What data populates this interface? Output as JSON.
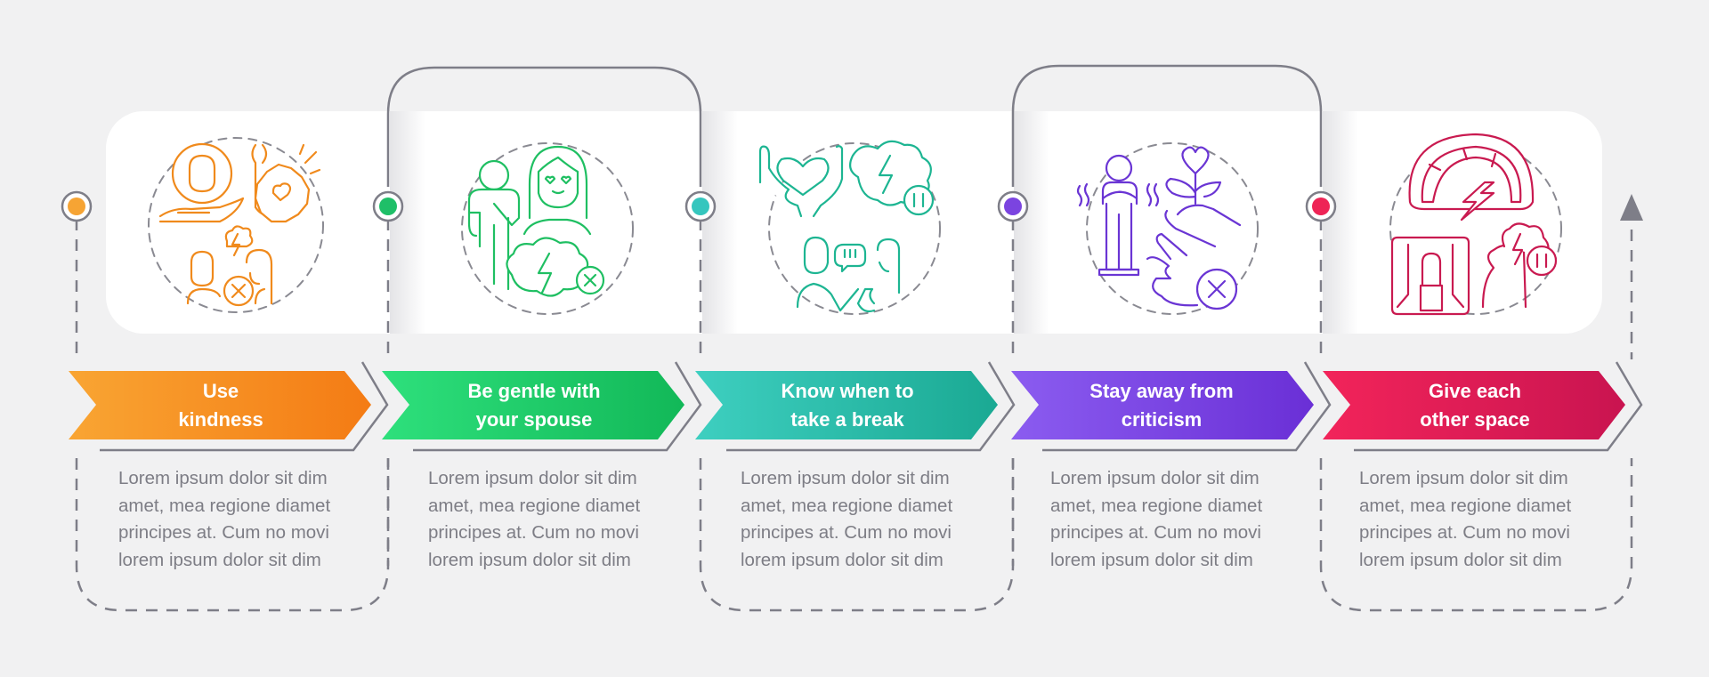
{
  "infographic": {
    "steps": [
      {
        "title": "Use\nkindness",
        "description": "Lorem ipsum dolor sit dim\namet, mea regione diamet\nprincipes at. Cum no movi\nlorem ipsum dolor sit dim",
        "icon": "kindness-icon",
        "color": "#f5841f",
        "gradient": [
          "#f9a533",
          "#f47b14"
        ],
        "dot_color": "#f6a434"
      },
      {
        "title": "Be gentle with\nyour spouse",
        "description": "Lorem ipsum dolor sit dim\namet, mea regione diamet\nprincipes at. Cum no movi\nlorem ipsum dolor sit dim",
        "icon": "gentle-spouse-icon",
        "color": "#21bf64",
        "gradient": [
          "#2ee07c",
          "#12b858"
        ],
        "dot_color": "#1fbf68"
      },
      {
        "title": "Know when to\ntake a break",
        "description": "Lorem ipsum dolor sit dim\namet, mea regione diamet\nprincipes at. Cum no movi\nlorem ipsum dolor sit dim",
        "icon": "take-break-icon",
        "color": "#1fae96",
        "gradient": [
          "#3ecfc0",
          "#1aa993"
        ],
        "dot_color": "#35c6be"
      },
      {
        "title": "Stay away from\ncriticism",
        "description": "Lorem ipsum dolor sit dim\namet, mea regione diamet\nprincipes at. Cum no movi\nlorem ipsum dolor sit dim",
        "icon": "avoid-criticism-icon",
        "color": "#7a3ce0",
        "gradient": [
          "#8b5cf0",
          "#6a2fd6"
        ],
        "dot_color": "#7b44e0"
      },
      {
        "title": "Give each\nother space",
        "description": "Lorem ipsum dolor sit dim\namet, mea regione diamet\nprincipes at. Cum no movi\nlorem ipsum dolor sit dim",
        "icon": "personal-space-icon",
        "color": "#cf1f55",
        "gradient": [
          "#f2245a",
          "#c91450"
        ],
        "dot_color": "#ee2456"
      }
    ],
    "connector_color": "#7e7e88",
    "end_arrow_icon": "arrow-up-icon"
  }
}
